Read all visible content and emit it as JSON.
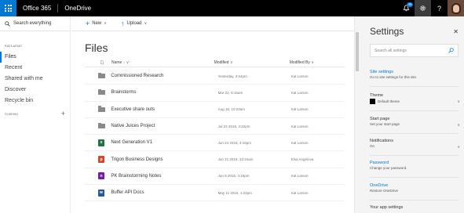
{
  "topbar": {
    "brand": "Office 365",
    "app_name": "OneDrive",
    "notification_count": "46"
  },
  "leftnav": {
    "search_placeholder": "Search everything",
    "user_name": "Kat Larson",
    "items": [
      {
        "label": "Files",
        "active": true
      },
      {
        "label": "Recent"
      },
      {
        "label": "Shared with me"
      },
      {
        "label": "Discover"
      },
      {
        "label": "Recycle bin"
      }
    ],
    "group_label": "Contoso"
  },
  "cmdbar": {
    "new_label": "New",
    "upload_label": "Upload"
  },
  "main": {
    "title": "Files",
    "columns": {
      "name": "Name",
      "modified": "Modified",
      "modified_by": "Modified By"
    },
    "rows": [
      {
        "type": "folder",
        "name": "Commissioned Research",
        "modified": "Yesterday, 3:54pm",
        "by": "Kat Larson"
      },
      {
        "type": "folder",
        "name": "Brainstorms",
        "modified": "Mar 22, 8:15am",
        "by": "Kat Larson"
      },
      {
        "type": "folder",
        "name": "Executive share outs",
        "modified": "Aug 18, 10:23am",
        "by": "Kat Larson"
      },
      {
        "type": "folder",
        "name": "Native Juices Project",
        "modified": "Jul 23 2016, 2:22pm",
        "by": "Kat Larson"
      },
      {
        "type": "excel",
        "name": "Next Generation V1",
        "modified": "Jun 24 2016, 4:16pm",
        "by": "Kat Larson"
      },
      {
        "type": "ppt",
        "name": "Trigon Business Designs",
        "modified": "Jun 21 2016, 10:24am",
        "by": "Elsa Angelova"
      },
      {
        "type": "onenote",
        "name": "PK Brainstorming Notes",
        "modified": "Jun 9 2016, 4:16pm",
        "by": "Kat Larson"
      },
      {
        "type": "word",
        "name": "Buffer API Docs",
        "modified": "May 11 2016, 1:22pm",
        "by": "Kat Larson"
      }
    ]
  },
  "settings": {
    "title": "Settings",
    "search_placeholder": "Search all settings",
    "site_settings_title": "Site settings",
    "site_settings_desc": "Go to site settings for this site.",
    "theme_title": "Theme",
    "theme_value": "Default theme",
    "start_page_title": "Start page",
    "start_page_value": "Set your start page",
    "notifications_title": "Notifications",
    "notifications_value": "On",
    "password_title": "Password",
    "password_desc": "Change your password.",
    "onedrive_title": "OneDrive",
    "onedrive_desc": "Restore OneDrive",
    "app_settings_title": "Your app settings"
  },
  "colors": {
    "accent": "#0078d4",
    "topbar": "#000000",
    "settings_bg": "#f4f4f4"
  }
}
